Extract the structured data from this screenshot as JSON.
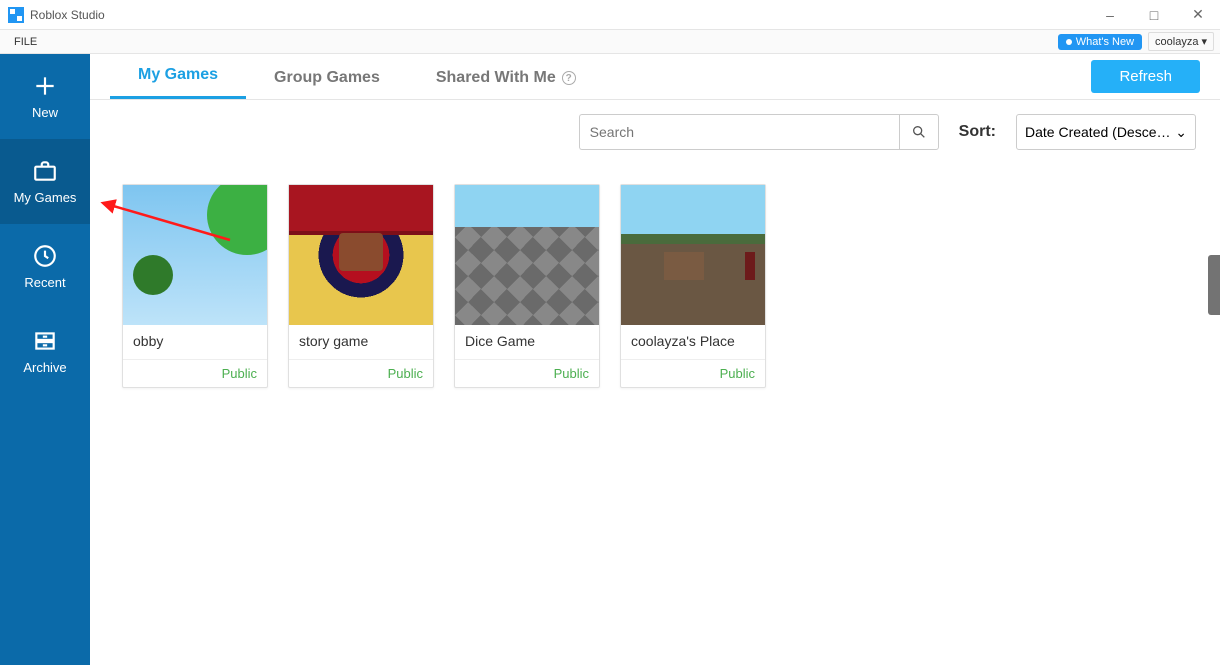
{
  "window": {
    "title": "Roblox Studio"
  },
  "menubar": {
    "file": "FILE"
  },
  "whats_new": {
    "label": "What's New"
  },
  "user": {
    "name": "coolayza"
  },
  "sidebar": {
    "items": [
      {
        "label": "New"
      },
      {
        "label": "My Games"
      },
      {
        "label": "Recent"
      },
      {
        "label": "Archive"
      }
    ],
    "active_index": 1
  },
  "tabs": {
    "items": [
      {
        "label": "My Games"
      },
      {
        "label": "Group Games"
      },
      {
        "label": "Shared With Me"
      }
    ],
    "active_index": 0
  },
  "refresh": {
    "label": "Refresh"
  },
  "search": {
    "placeholder": "Search",
    "value": ""
  },
  "sort": {
    "label": "Sort:",
    "selected": "Date Created (Desce…"
  },
  "games": [
    {
      "title": "obby",
      "status": "Public"
    },
    {
      "title": "story game",
      "status": "Public"
    },
    {
      "title": "Dice Game",
      "status": "Public"
    },
    {
      "title": "coolayza's Place",
      "status": "Public"
    }
  ]
}
